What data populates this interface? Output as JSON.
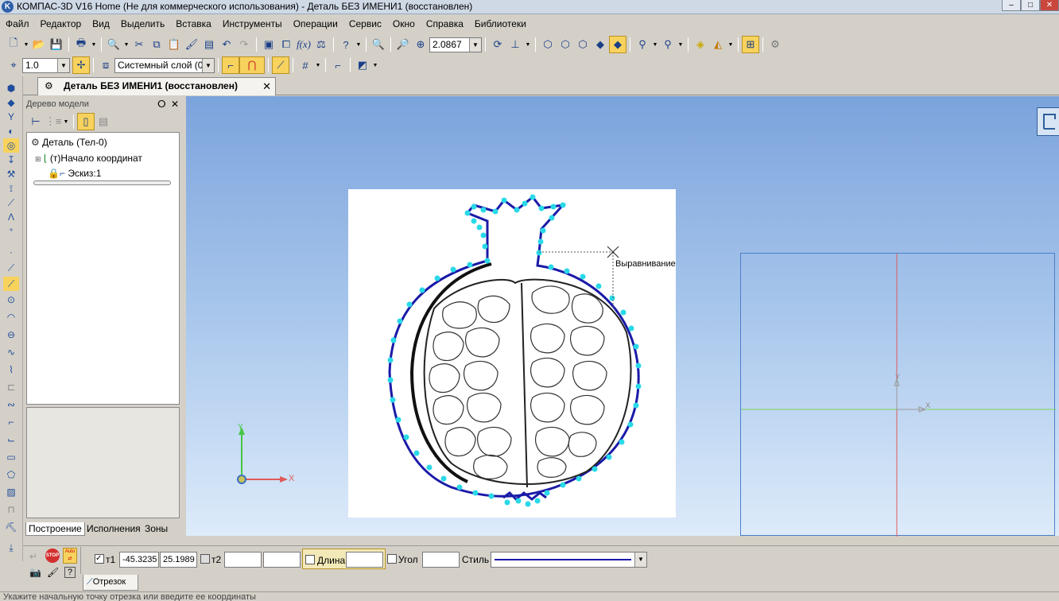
{
  "window": {
    "title": "КОМПАС-3D V16 Home  (Не для коммерческого использования) - Деталь БЕЗ ИМЕНИ1 (восстановлен)",
    "app_icon_letter": "K",
    "minimize": "–",
    "maximize": "□",
    "close": "✕"
  },
  "menu": [
    "Файл",
    "Редактор",
    "Вид",
    "Выделить",
    "Вставка",
    "Инструменты",
    "Операции",
    "Сервис",
    "Окно",
    "Справка",
    "Библиотеки"
  ],
  "toolbar": {
    "zoom_value": "2.0867",
    "line_scale": "1.0",
    "layer": "Системный слой (0)"
  },
  "document": {
    "tab_label": "Деталь БЕЗ ИМЕНИ1 (восстановлен)",
    "tab_close": "✕"
  },
  "tree": {
    "header": "Дерево модели",
    "pin": "ꟷ",
    "close": "✕",
    "root": "Деталь (Тел-0)",
    "origin": "(т)Начало координат",
    "sketch": "Эскиз:1",
    "tabs": [
      "Построение",
      "Исполнения",
      "Зоны"
    ]
  },
  "viewport": {
    "hint_label": "Выравнивание",
    "axis_x": "X",
    "axis_y": "Y"
  },
  "command_panel": {
    "stop_label": "STOP",
    "auto_label": "Auto",
    "t1_label": "т1",
    "t1_x": "-45.3235",
    "t1_y": "25.1989",
    "t2_label": "т2",
    "t2_x": "",
    "t2_y": "",
    "length_label": "Длина",
    "length_value": "",
    "angle_label": "Угол",
    "angle_value": "",
    "style_label": "Стиль",
    "command_tab": "Отрезок"
  },
  "status": {
    "text": "Укажите начальную точку отрезка или введите ее координаты"
  },
  "colors": {
    "accent_highlight": "#f7d25d",
    "sketch_points": "#29d9e8",
    "contour": "#1a1aa8",
    "axis_x": "#e05a5a",
    "axis_y": "#45c545"
  }
}
